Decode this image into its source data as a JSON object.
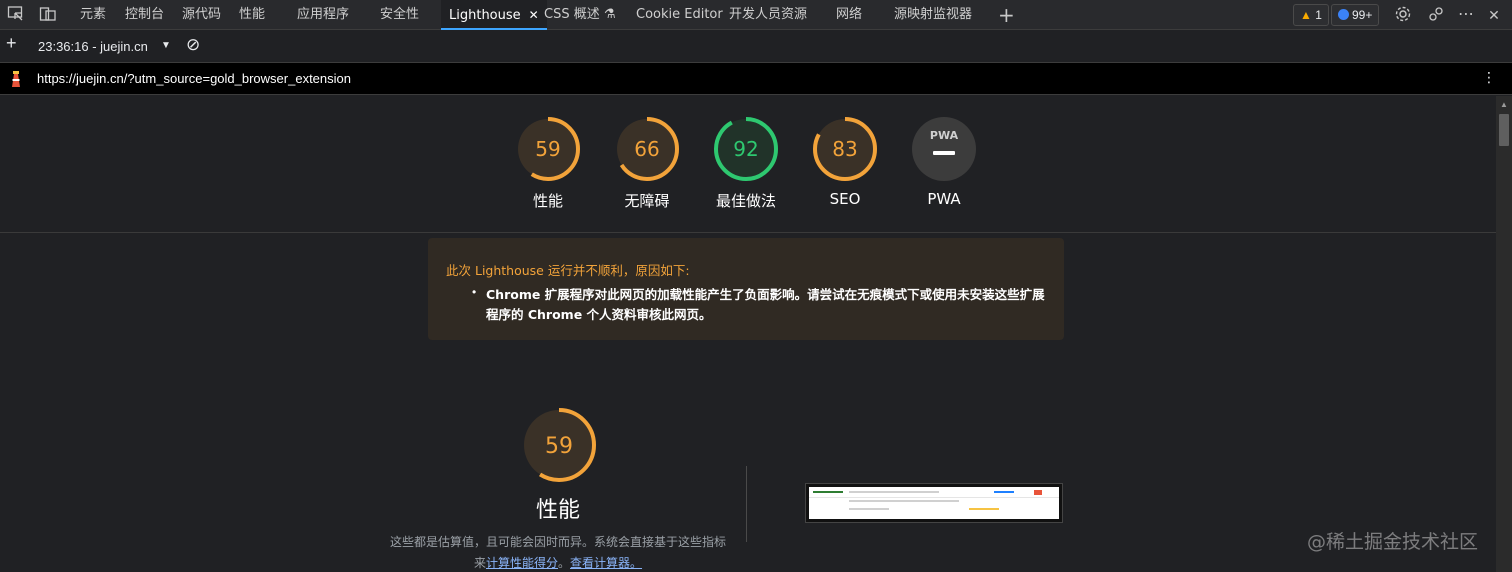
{
  "tabbar": {
    "tabs": [
      {
        "label": "元素"
      },
      {
        "label": "控制台"
      },
      {
        "label": "源代码"
      },
      {
        "label": "性能"
      },
      {
        "label": "应用程序"
      },
      {
        "label": "安全性"
      },
      {
        "label": "Lighthouse",
        "active": true,
        "close": "✕"
      },
      {
        "label": "CSS 概述 ⚗"
      },
      {
        "label": "Cookie Editor"
      },
      {
        "label": "开发人员资源"
      },
      {
        "label": "网络"
      },
      {
        "label": "源映射监视器"
      }
    ],
    "add_tab": "+",
    "warnings_count": "1",
    "issues_count": "99+",
    "more": "⋯"
  },
  "toolbar": {
    "add": "+",
    "report_label": "23:36:16 - juejin.cn",
    "dropdown": "▼",
    "clear": "⊘"
  },
  "urlbar": {
    "url": "https://juejin.cn/?utm_source=gold_browser_extension",
    "menu": "⋮"
  },
  "scores": [
    {
      "value": "59",
      "label": "性能",
      "score": 0.59,
      "color": "#f2a33a"
    },
    {
      "value": "66",
      "label": "无障碍",
      "score": 0.66,
      "color": "#f2a33a"
    },
    {
      "value": "92",
      "label": "最佳做法",
      "score": 0.92,
      "color": "#2ec870"
    },
    {
      "value": "83",
      "label": "SEO",
      "score": 0.83,
      "color": "#f2a33a"
    },
    {
      "value": "PWA",
      "label": "PWA",
      "score": null,
      "color": "#9aa0a6"
    }
  ],
  "warning": {
    "title": "此次 Lighthouse 运行并不顺利，原因如下:",
    "items": [
      "Chrome 扩展程序对此网页的加载性能产生了负面影响。请尝试在无痕模式下或使用未安装这些扩展程序的 Chrome 个人资料审核此网页。"
    ]
  },
  "performance": {
    "score": "59",
    "score_fraction": 0.59,
    "title": "性能",
    "desc_prefix": "这些都是估算值，且可能会因时而异。系统会直接基于这些指标来",
    "link_calc": "计算性能得分",
    "sep": "。",
    "link_calculator": "查看计算器。"
  },
  "watermark": "@稀土掘金技术社区",
  "colors": {
    "average": "#f2a33a",
    "pass": "#2ec870",
    "link": "#8ab4f8",
    "accent": "#3ea6ff"
  }
}
